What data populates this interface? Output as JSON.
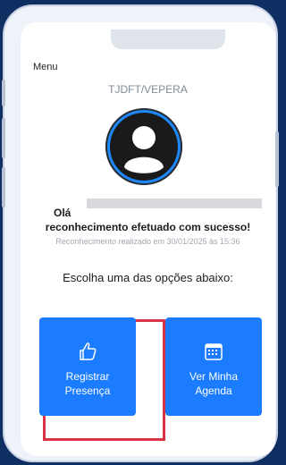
{
  "header": {
    "menu_label": "Menu"
  },
  "organization": "TJDFT/VEPERA",
  "greeting": {
    "prefix": "Olá",
    "message": "reconhecimento efetuado com sucesso!"
  },
  "status": {
    "timestamp_text": "Reconhecimento realizado em 30/01/2025 às 15:36"
  },
  "prompt": {
    "text": "Escolha uma das opções abaixo:"
  },
  "actions": [
    {
      "label_line1": "Registrar",
      "label_line2": "Presença",
      "icon": "thumbs-up-icon"
    },
    {
      "label_line1": "Ver Minha",
      "label_line2": "Agenda",
      "icon": "calendar-icon"
    }
  ],
  "colors": {
    "accent": "#1b7cff",
    "highlight": "#d83345",
    "background": "#0f2f63"
  }
}
